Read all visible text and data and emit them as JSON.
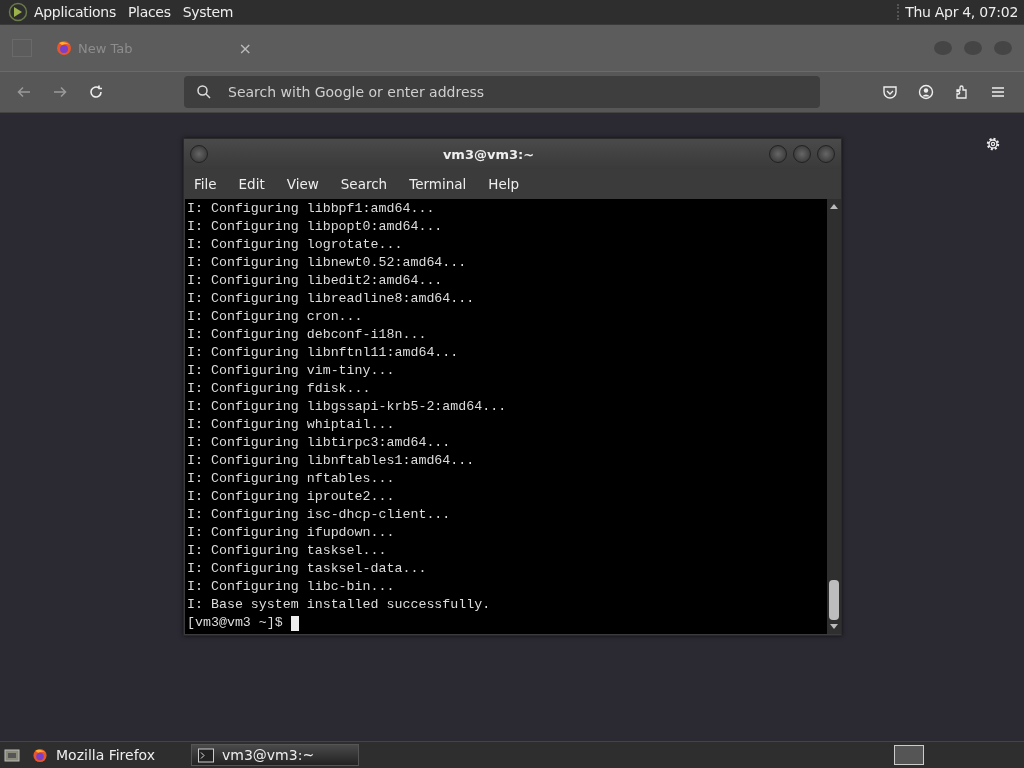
{
  "top_panel": {
    "menus": [
      "Applications",
      "Places",
      "System"
    ],
    "clock": "Thu Apr  4, 07:02"
  },
  "browser": {
    "tab": {
      "title": "New Tab",
      "close": "×"
    },
    "address": {
      "placeholder": "Search with Google or enter address"
    }
  },
  "terminal": {
    "title": "vm3@vm3:~",
    "menu": [
      "File",
      "Edit",
      "View",
      "Search",
      "Terminal",
      "Help"
    ],
    "lines": [
      "I: Configuring libbpf1:amd64...",
      "I: Configuring libpopt0:amd64...",
      "I: Configuring logrotate...",
      "I: Configuring libnewt0.52:amd64...",
      "I: Configuring libedit2:amd64...",
      "I: Configuring libreadline8:amd64...",
      "I: Configuring cron...",
      "I: Configuring debconf-i18n...",
      "I: Configuring libnftnl11:amd64...",
      "I: Configuring vim-tiny...",
      "I: Configuring fdisk...",
      "I: Configuring libgssapi-krb5-2:amd64...",
      "I: Configuring whiptail...",
      "I: Configuring libtirpc3:amd64...",
      "I: Configuring libnftables1:amd64...",
      "I: Configuring nftables...",
      "I: Configuring iproute2...",
      "I: Configuring isc-dhcp-client...",
      "I: Configuring ifupdown...",
      "I: Configuring tasksel...",
      "I: Configuring tasksel-data...",
      "I: Configuring libc-bin...",
      "I: Base system installed successfully."
    ],
    "prompt": "[vm3@vm3 ~]$"
  },
  "taskbar": {
    "items": [
      {
        "label": "Mozilla Firefox",
        "kind": "firefox",
        "selected": false
      },
      {
        "label": "vm3@vm3:~",
        "kind": "terminal",
        "selected": true
      }
    ]
  }
}
